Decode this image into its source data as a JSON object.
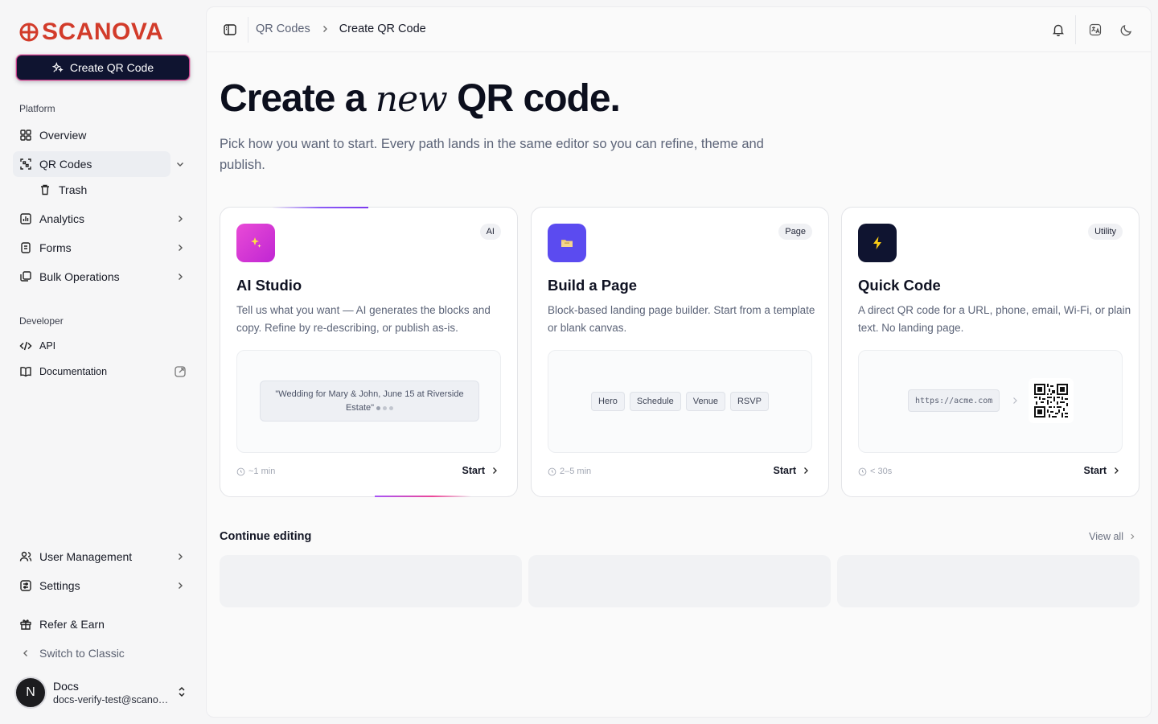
{
  "brand": {
    "name": "SCANOVA",
    "color": "#d23b2a"
  },
  "sidebar": {
    "create_label": "Create QR Code",
    "platform_label": "Platform",
    "developer_label": "Developer",
    "items": {
      "overview": "Overview",
      "qr_codes": "QR Codes",
      "trash": "Trash",
      "analytics": "Analytics",
      "forms": "Forms",
      "bulk": "Bulk Operations",
      "api": "API",
      "docs": "Documentation",
      "user_mgmt": "User Management",
      "settings": "Settings",
      "refer": "Refer & Earn",
      "classic": "Switch to Classic"
    },
    "user": {
      "initial": "N",
      "name": "Docs",
      "email": "docs-verify-test@scanova.io"
    }
  },
  "topbar": {
    "breadcrumb": [
      "QR Codes",
      "Create QR Code"
    ],
    "icons": [
      "sidebar-toggle-icon",
      "bell-icon",
      "language-icon",
      "moon-icon"
    ]
  },
  "hero": {
    "title_start": "Create a ",
    "title_emph": "new",
    "title_end": " QR code.",
    "subtitle": "Pick how you want to start. Every path lands in the same editor so you can refine, theme and publish."
  },
  "cards": [
    {
      "badge": "AI",
      "title": "AI Studio",
      "desc": "Tell us what you want — AI generates the blocks and copy. Refine by re-describing, or publish as-is.",
      "prompt": "\"Wedding for Mary & John, June 15 at Riverside Estate\"",
      "time": "~1 min",
      "start": "Start",
      "icon_color": "#d946ef"
    },
    {
      "badge": "Page",
      "title": "Build a Page",
      "desc": "Block-based landing page builder. Start from a template or blank canvas.",
      "chips": [
        "Hero",
        "Schedule",
        "Venue",
        "RSVP"
      ],
      "time": "2–5 min",
      "start": "Start",
      "icon_color": "#5b4bf0"
    },
    {
      "badge": "Utility",
      "title": "Quick Code",
      "desc": "A direct QR code for a URL, phone, email, Wi-Fi, or plain text. No landing page.",
      "url": "https://acme.com",
      "time": "< 30s",
      "start": "Start",
      "icon_color": "#0f1430"
    }
  ],
  "continue": {
    "title": "Continue editing",
    "view_all": "View all"
  }
}
